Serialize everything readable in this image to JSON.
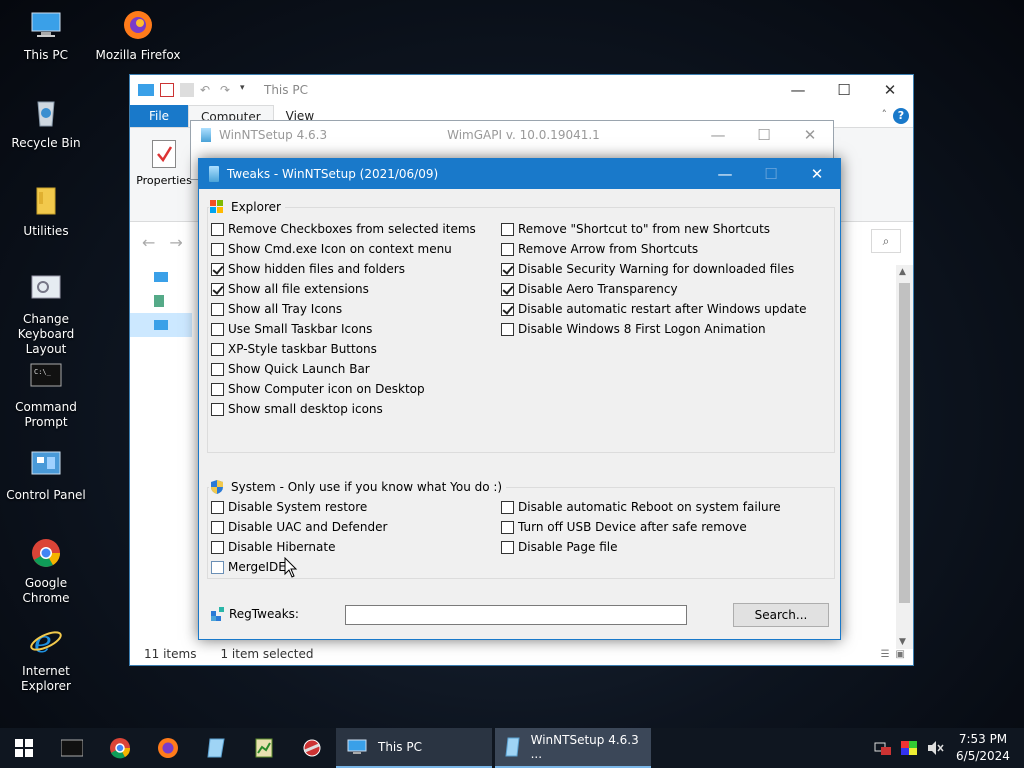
{
  "desktop": {
    "icons": [
      {
        "label": "This PC"
      },
      {
        "label": "Mozilla Firefox"
      },
      {
        "label": "Recycle Bin"
      },
      {
        "label": "Utilities"
      },
      {
        "label": "Change\nKeyboard Layout"
      },
      {
        "label": "Command\nPrompt"
      },
      {
        "label": "Control Panel"
      },
      {
        "label": "Google Chrome"
      },
      {
        "label": "Internet Explorer"
      }
    ]
  },
  "explorer": {
    "title": "This PC",
    "tabs": {
      "file": "File",
      "computer": "Computer",
      "view": "View"
    },
    "ribbon_properties": "Properties",
    "help": "?",
    "status": {
      "items": "11 items",
      "selected": "1 item selected"
    }
  },
  "winntsetup": {
    "title": "WinNTSetup 4.6.3",
    "version": "WimGAPI v. 10.0.19041.1"
  },
  "tweaks": {
    "title": "Tweaks - WinNTSetup (2021/06/09)",
    "explorer_group": "Explorer",
    "explorer_left": [
      {
        "label": "Remove Checkboxes from selected items",
        "checked": false
      },
      {
        "label": "Show Cmd.exe Icon on context menu",
        "checked": false
      },
      {
        "label": "Show hidden files and folders",
        "checked": true
      },
      {
        "label": "Show all file extensions",
        "checked": true
      },
      {
        "label": "Show all Tray Icons",
        "checked": false
      },
      {
        "label": "Use Small Taskbar Icons",
        "checked": false
      },
      {
        "label": "XP-Style taskbar Buttons",
        "checked": false
      },
      {
        "label": "Show Quick Launch Bar",
        "checked": false
      },
      {
        "label": "Show Computer icon on Desktop",
        "checked": false
      },
      {
        "label": "Show small desktop icons",
        "checked": false
      }
    ],
    "explorer_right": [
      {
        "label": "Remove \"Shortcut to\" from new Shortcuts",
        "checked": false
      },
      {
        "label": "Remove Arrow from Shortcuts",
        "checked": false
      },
      {
        "label": "Disable Security Warning for downloaded files",
        "checked": true
      },
      {
        "label": "Disable Aero Transparency",
        "checked": true
      },
      {
        "label": "Disable automatic restart after Windows update",
        "checked": true
      },
      {
        "label": "Disable Windows 8 First Logon Animation",
        "checked": false
      }
    ],
    "system_group": "System - Only use if you know what You do :)",
    "system_left": [
      {
        "label": "Disable System restore",
        "checked": false
      },
      {
        "label": "Disable UAC and Defender",
        "checked": false
      },
      {
        "label": "Disable Hibernate",
        "checked": false
      },
      {
        "label": "MergeIDE",
        "checked": false
      }
    ],
    "system_right": [
      {
        "label": "Disable automatic Reboot on system failure",
        "checked": false
      },
      {
        "label": "Turn off USB Device after safe remove",
        "checked": false
      },
      {
        "label": "Disable Page file",
        "checked": false
      }
    ],
    "regtweaks_label": "RegTweaks:",
    "regtweaks_value": "",
    "search_button": "Search..."
  },
  "taskbar": {
    "tasks": [
      {
        "label": "This PC"
      },
      {
        "label": "WinNTSetup 4.6.3 ..."
      }
    ],
    "time": "7:53 PM",
    "date": "6/5/2024"
  }
}
